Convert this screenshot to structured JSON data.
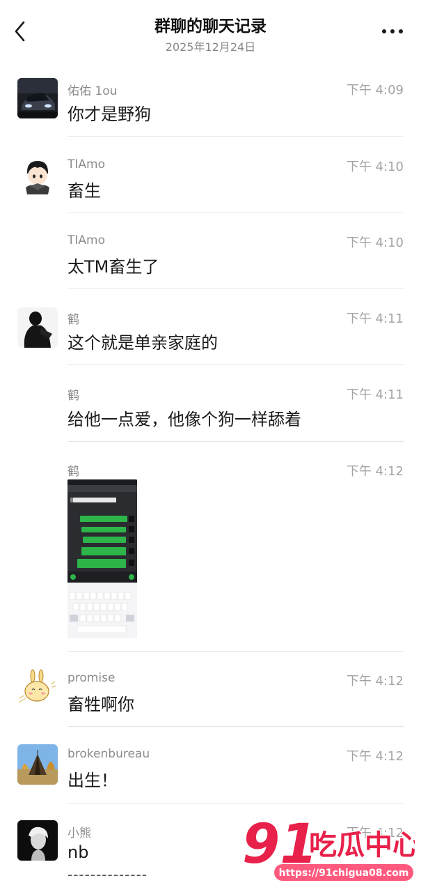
{
  "header": {
    "title": "群聊的聊天记录",
    "date": "2025年12月24日",
    "back_icon": "chevron-left-icon",
    "more_icon": "more-icon"
  },
  "messages": [
    {
      "sender": "佑佑 1ou",
      "time": "下午 4:09",
      "text": "你才是野狗",
      "avatar": "car-photo-avatar"
    },
    {
      "sender": "TIAmo",
      "time": "下午 4:10",
      "text": "畜生",
      "avatar": "cartoon-boy-avatar"
    },
    {
      "sender": "TIAmo",
      "time": "下午 4:10",
      "text": "太TM畜生了"
    },
    {
      "sender": "鹤",
      "time": "下午 4:11",
      "text": "这个就是单亲家庭的",
      "avatar": "dark-figure-avatar"
    },
    {
      "sender": "鹤",
      "time": "下午 4:11",
      "text": "给他一点爱，他像个狗一样舔着"
    },
    {
      "sender": "鹤",
      "time": "下午 4:12",
      "image": "chat-screenshot-image"
    },
    {
      "sender": "promise",
      "time": "下午 4:12",
      "text": "畜牲啊你",
      "avatar": "bunny-avatar"
    },
    {
      "sender": "brokenbureau",
      "time": "下午 4:12",
      "text": "出生！",
      "avatar": "tent-photo-avatar"
    },
    {
      "sender": "小熊",
      "time": "下午 4:12",
      "text": "nb",
      "extra": "--------------",
      "avatar": "portrait-avatar"
    }
  ],
  "watermark": {
    "number": "91",
    "name": "吃瓜中心",
    "url": "https://91chigua08.com"
  },
  "colors": {
    "watermark_red": "#e8214a",
    "watermark_pink": "#ff5a7e",
    "chat_green": "#2db54a",
    "time_gray": "#a3a3a3"
  }
}
